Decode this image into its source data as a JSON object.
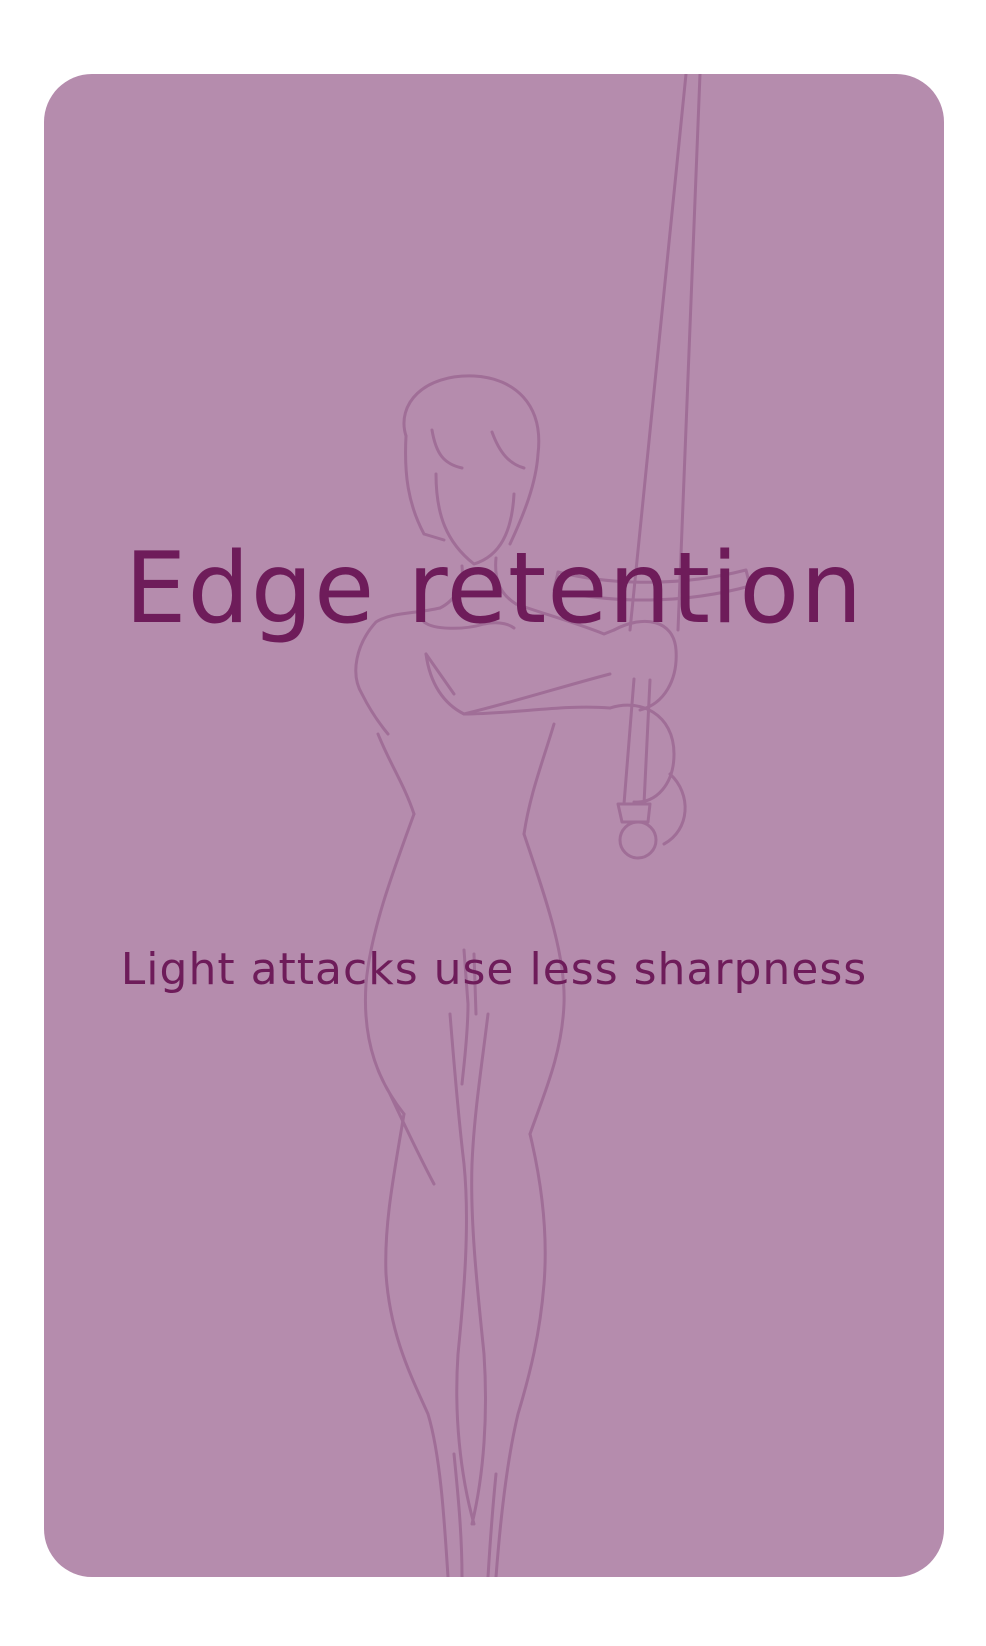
{
  "card": {
    "title": "Edge retention",
    "description": "Light attacks use less sharpness",
    "art": "swordswoman-line-art"
  },
  "colors": {
    "card_background": "#b58cad",
    "text": "#6e1c5a",
    "line_art": "#a06e97"
  }
}
